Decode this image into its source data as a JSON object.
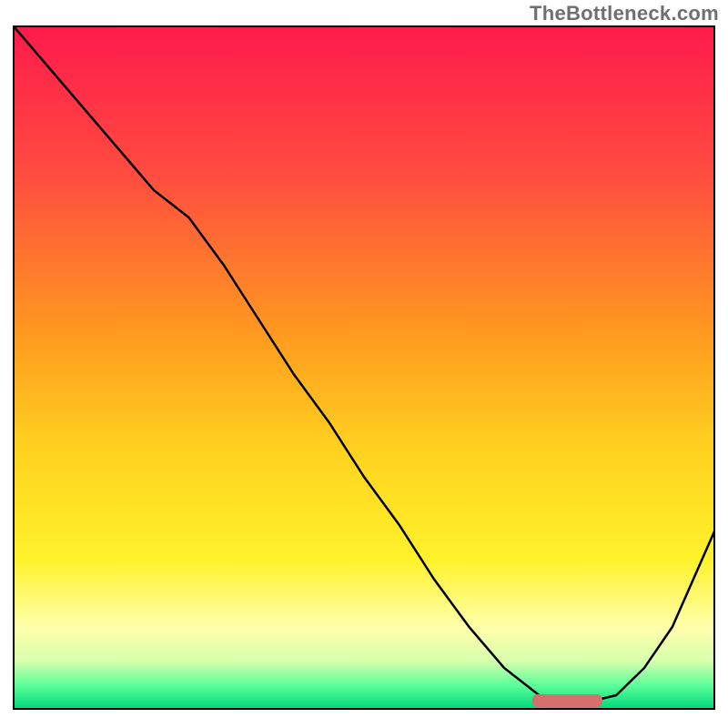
{
  "watermark": "TheBottleneck.com",
  "colors": {
    "gradient_stops": [
      {
        "offset": 0.0,
        "color": "#ff1a4b"
      },
      {
        "offset": 0.22,
        "color": "#ff4d3f"
      },
      {
        "offset": 0.45,
        "color": "#ff9a1f"
      },
      {
        "offset": 0.62,
        "color": "#ffd21f"
      },
      {
        "offset": 0.78,
        "color": "#fff22a"
      },
      {
        "offset": 0.88,
        "color": "#ffffaa"
      },
      {
        "offset": 0.93,
        "color": "#d8ffad"
      },
      {
        "offset": 0.965,
        "color": "#5eff9a"
      },
      {
        "offset": 1.0,
        "color": "#00d879"
      }
    ],
    "curve_stroke": "#000000",
    "marker_fill": "#d6706d"
  },
  "chart_data": {
    "type": "line",
    "title": "",
    "xlabel": "",
    "ylabel": "",
    "xlim": [
      0,
      100
    ],
    "ylim": [
      0,
      100
    ],
    "grid": false,
    "legend": false,
    "series": [
      {
        "name": "bottleneck-curve",
        "x": [
          0,
          5,
          10,
          15,
          20,
          25,
          30,
          35,
          40,
          45,
          50,
          55,
          60,
          65,
          70,
          75,
          78,
          82,
          86,
          90,
          94,
          97,
          100
        ],
        "y": [
          100,
          94,
          88,
          82,
          76,
          72,
          65,
          57,
          49,
          42,
          34,
          27,
          19,
          12,
          6,
          2,
          1,
          1,
          2,
          6,
          12,
          19,
          26
        ]
      }
    ],
    "marker": {
      "name": "optimal-range",
      "x_start": 74,
      "x_end": 84,
      "y": 1.2
    },
    "annotations": [
      {
        "text": "TheBottleneck.com",
        "role": "watermark",
        "position": "top-right"
      }
    ]
  }
}
